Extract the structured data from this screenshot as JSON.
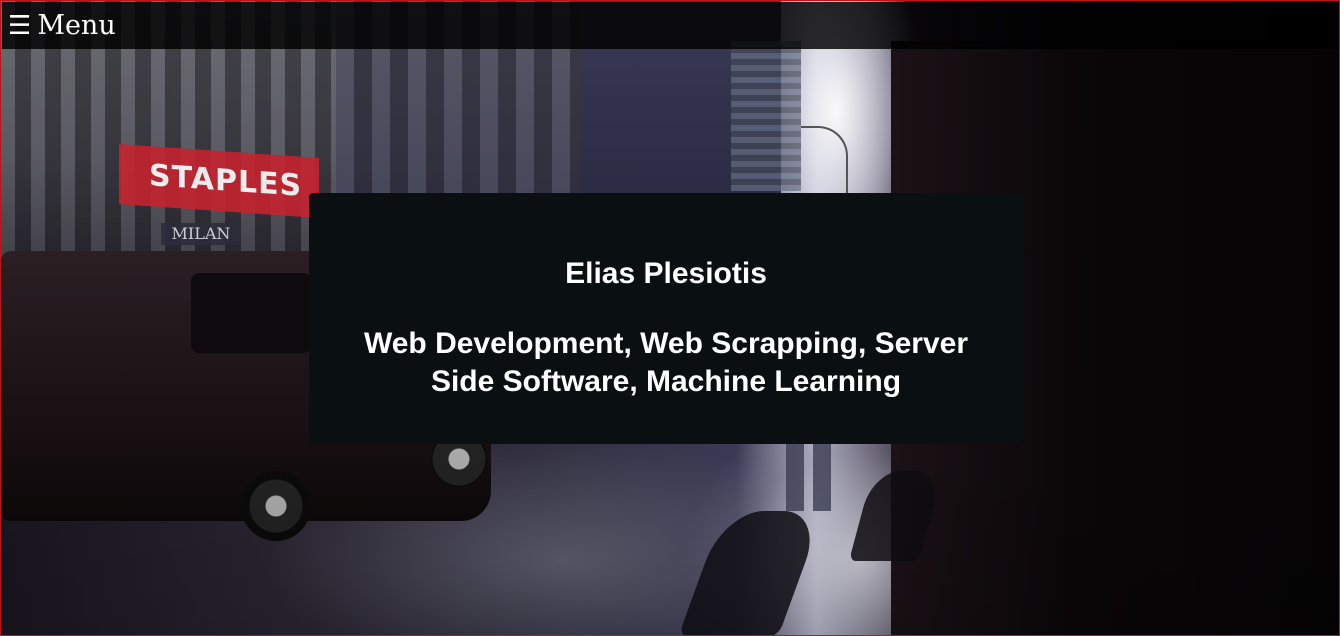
{
  "header": {
    "menu_icon": "hamburger-icon",
    "menu_icon_glyph": "☰",
    "menu_label": "Menu"
  },
  "hero": {
    "background_image": "street-photo",
    "photo_signs": {
      "store_name": "STAPLES",
      "secondary_sign": "MILAN"
    }
  },
  "intro": {
    "name": "Elias Plesiotis",
    "tagline": "Web Development, Web Scrapping, Server Side Software, Machine Learning"
  },
  "colors": {
    "card_background": "#0a0f12",
    "menu_bar_background": "#000000",
    "text": "#ffffff",
    "page_border": "#c0141c"
  }
}
